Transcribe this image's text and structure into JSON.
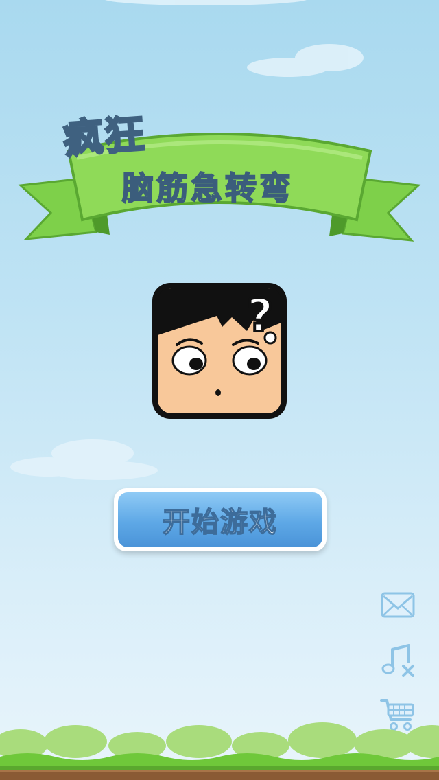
{
  "title": {
    "line1": "疯狂",
    "line2": "脑筋急转弯"
  },
  "buttons": {
    "start_label": "开始游戏"
  },
  "icons": {
    "mail": "mail-icon",
    "music_off": "music-off-icon",
    "cart": "shopping-cart-icon",
    "mascot": "confused-face-icon"
  },
  "colors": {
    "sky_top": "#a9d9ef",
    "ribbon_green": "#7ed04a",
    "button_blue": "#5ea8e6",
    "face_skin": "#f8c89a",
    "grass_green": "#6fc83a",
    "dirt_brown": "#8a5a34"
  }
}
